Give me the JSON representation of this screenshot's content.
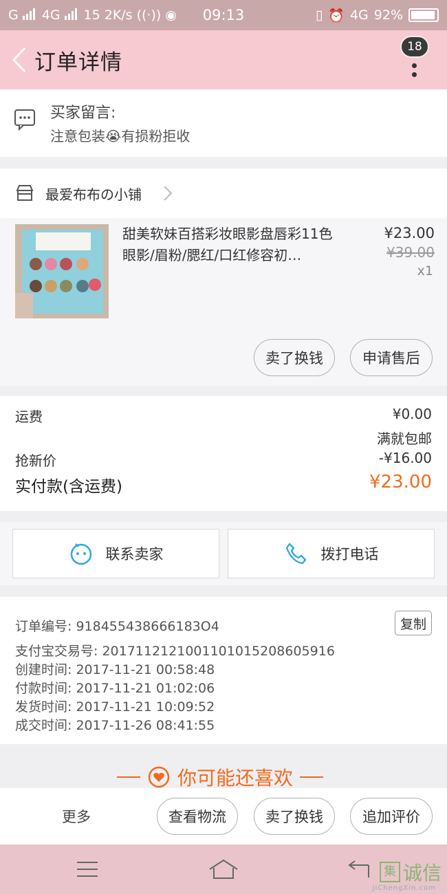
{
  "status_bar": {
    "network": "G",
    "network2": "4G",
    "speed": "15",
    "speed_unit": "2K/s",
    "time": "09:13",
    "network_right": "4G",
    "battery": "92%"
  },
  "nav": {
    "title": "订单详情",
    "badge_count": "18"
  },
  "buyer_message": {
    "label": "买家留言:",
    "text": "注意包装😭有损粉拒收"
  },
  "shop": {
    "name": "最爱布布の小铺"
  },
  "product": {
    "title": "甜美软妹百搭彩妆眼影盘唇彩11色 眼影/眉粉/腮红/口红修容初…",
    "price": "¥23.00",
    "original_price": "¥39.00",
    "quantity": "x1",
    "sell_button": "卖了换钱",
    "after_sale_button": "申请售后"
  },
  "fees": {
    "shipping_label": "运费",
    "shipping_value": "¥0.00",
    "shipping_note": "满就包邮",
    "discount_label": "抢新价",
    "discount_value": "-¥16.00",
    "total_label": "实付款(含运费)",
    "total_value": "¥23.00"
  },
  "contact": {
    "seller_label": "联系卖家",
    "phone_label": "拨打电话"
  },
  "order_info": {
    "order_no": "订单编号: 918455438666183O4",
    "copy_label": "复制",
    "alipay_no": "支付宝交易号: 2017112121001101015208605916",
    "created": "创建时间: 2017-11-21 00:58:48",
    "paid": "付款时间: 2017-11-21 01:02:06",
    "shipped": "发货时间: 2017-11-21 10:09:52",
    "completed": "成交时间: 2017-11-26 08:41:55"
  },
  "recommend": {
    "title": "你可能还喜欢"
  },
  "bottom_bar": {
    "more": "更多",
    "logistics": "查看物流",
    "sell": "卖了换钱",
    "review": "追加评价"
  },
  "watermark": {
    "text": "诚信",
    "url": "JiChengXin.com"
  },
  "colors": {
    "status_bar": "#c9a8aa",
    "nav_bar": "#f7c9d0",
    "accent_orange": "#f26b1d",
    "contact_icon": "#2ea7e0"
  }
}
